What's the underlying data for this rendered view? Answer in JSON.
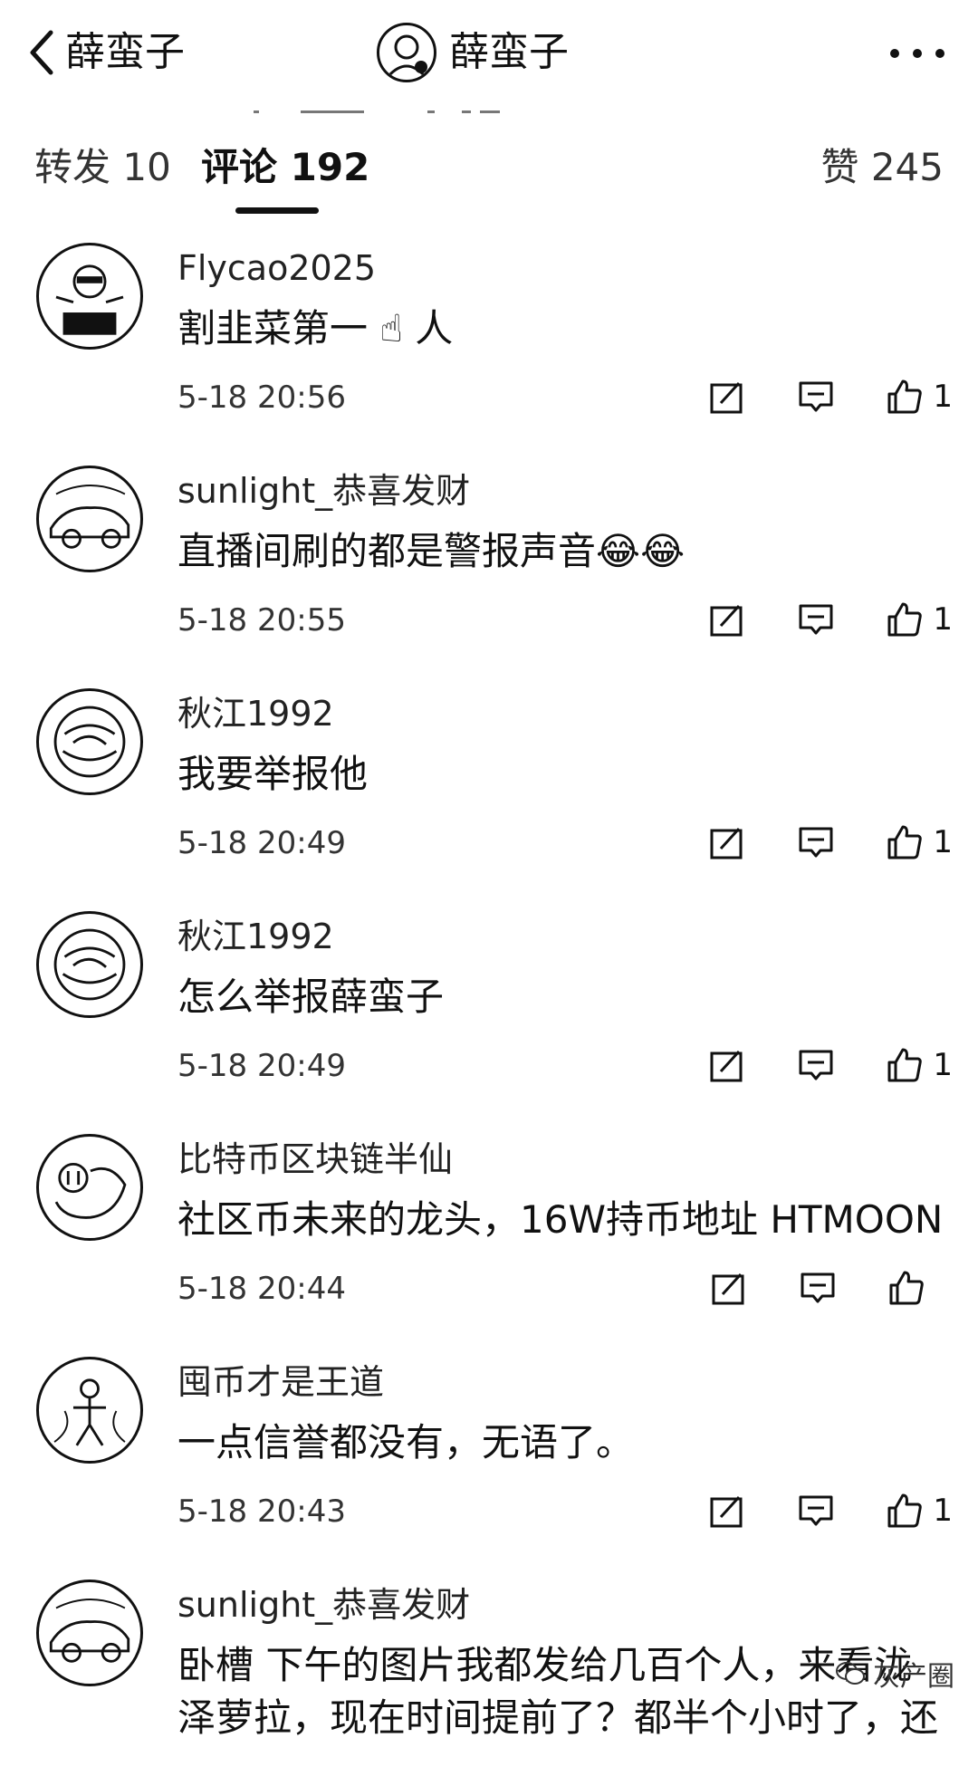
{
  "header": {
    "back_label": "薛蛮子",
    "title": "薛蛮子"
  },
  "tabs": {
    "repost": "转发 10",
    "comments": "评论 192",
    "likes": "赞 245"
  },
  "comments": [
    {
      "user": "Flycao2025",
      "text": "割韭菜第一 ☝ 人",
      "time": "5-18 20:56",
      "likes": "1"
    },
    {
      "user": "sunlight_恭喜发财",
      "text": "直播间刷的都是警报声音😂😂",
      "time": "5-18 20:55",
      "likes": "1"
    },
    {
      "user": "秋江1992",
      "text": "我要举报他",
      "time": "5-18 20:49",
      "likes": "1"
    },
    {
      "user": "秋江1992",
      "text": "怎么举报薛蛮子",
      "time": "5-18 20:49",
      "likes": "1"
    },
    {
      "user": "比特币区块链半仙",
      "text": "社区币未来的龙头，16W持币地址 HTMOON",
      "time": "5-18 20:44",
      "likes": ""
    },
    {
      "user": "囤币才是王道",
      "text": "一点信誉都没有，无语了。",
      "time": "5-18 20:43",
      "likes": "1"
    },
    {
      "user": "sunlight_恭喜发财",
      "text": "卧槽 下午的图片我都发给几百个人，来看泷泽萝拉，现在时间提前了？都半个小时了，还",
      "time": "",
      "likes": ""
    }
  ],
  "watermark": "灰产圈",
  "icons": {
    "back": "chevron-left-icon",
    "more": "more-dots-icon",
    "repost": "repost-icon",
    "reply": "comment-icon",
    "like": "thumbs-up-icon"
  }
}
